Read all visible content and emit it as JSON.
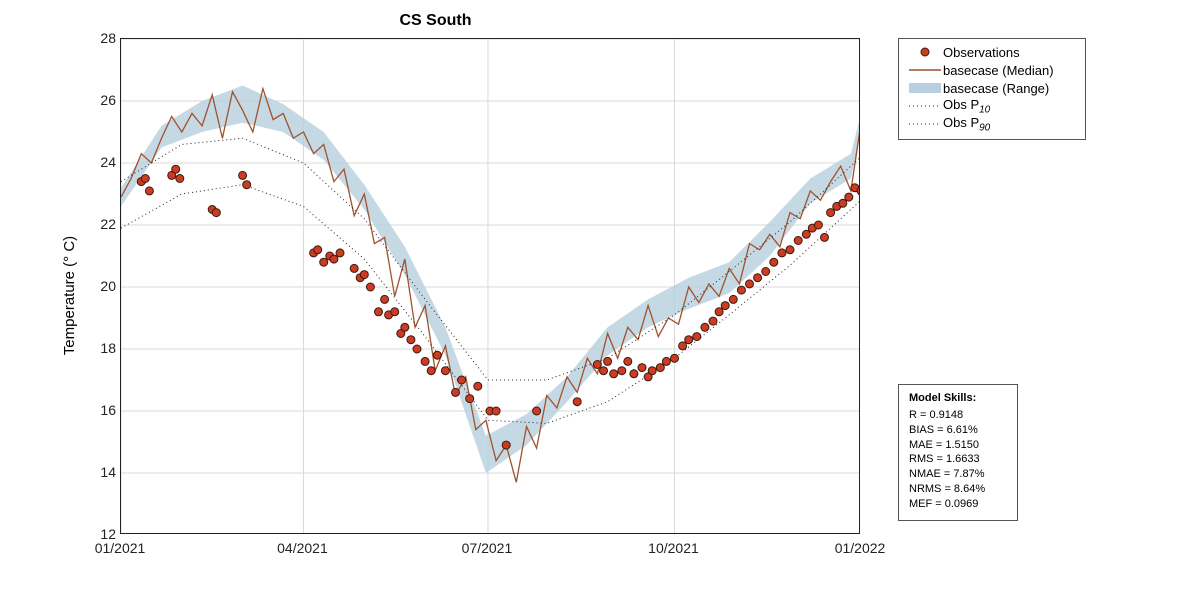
{
  "title": "CS South",
  "ylabel": "Temperature (° C)",
  "legend": {
    "obs": "Observations",
    "median": "basecase (Median)",
    "range": "basecase (Range)",
    "p10": "Obs P",
    "p10sub": "10",
    "p90": "Obs P",
    "p90sub": "90"
  },
  "skills": {
    "title": "Model Skills:",
    "R": "R     = 0.9148",
    "BIAS": "BIAS = 6.61%",
    "MAE": "MAE  = 1.5150",
    "RMS": "RMS  = 1.6633",
    "NMAE": "NMAE = 7.87%",
    "NRMS": "NRMS = 8.64%",
    "MEF": "MEF  = 0.0969"
  },
  "axes": {
    "xlim": [
      0,
      365
    ],
    "ylim": [
      12,
      28
    ],
    "xticks": [
      {
        "v": 0,
        "label": "01/2021"
      },
      {
        "v": 90,
        "label": "04/2021"
      },
      {
        "v": 181,
        "label": "07/2021"
      },
      {
        "v": 273,
        "label": "10/2021"
      },
      {
        "v": 365,
        "label": "01/2022"
      }
    ],
    "yticks": [
      12,
      14,
      16,
      18,
      20,
      22,
      24,
      26,
      28
    ]
  },
  "chart_data": {
    "type": "line",
    "title": "CS South",
    "xlabel": "",
    "ylabel": "Temperature (° C)",
    "xlim": [
      0,
      365
    ],
    "ylim": [
      12,
      28
    ],
    "x_tick_labels": [
      "01/2021",
      "04/2021",
      "07/2021",
      "10/2021",
      "01/2022"
    ],
    "series": [
      {
        "name": "basecase (Median)",
        "x": [
          0,
          5,
          10,
          15,
          20,
          25,
          30,
          35,
          40,
          45,
          50,
          55,
          60,
          65,
          70,
          75,
          80,
          85,
          90,
          95,
          100,
          105,
          110,
          115,
          120,
          125,
          130,
          135,
          140,
          145,
          150,
          155,
          160,
          165,
          170,
          175,
          180,
          185,
          190,
          195,
          200,
          205,
          210,
          215,
          220,
          225,
          230,
          235,
          240,
          245,
          250,
          255,
          260,
          265,
          270,
          275,
          280,
          285,
          290,
          295,
          300,
          305,
          310,
          315,
          320,
          325,
          330,
          335,
          340,
          345,
          350,
          355,
          360,
          365
        ],
        "y": [
          22.9,
          23.5,
          24.3,
          24.0,
          24.8,
          25.5,
          25.0,
          25.6,
          25.2,
          26.2,
          24.8,
          26.3,
          25.7,
          25.0,
          26.4,
          25.4,
          25.6,
          24.8,
          25.0,
          24.3,
          24.6,
          23.4,
          23.8,
          22.3,
          23.0,
          21.4,
          21.6,
          19.7,
          20.9,
          18.7,
          19.4,
          17.3,
          18.1,
          16.5,
          17.1,
          15.4,
          15.7,
          14.4,
          14.9,
          13.7,
          15.5,
          14.8,
          16.5,
          16.1,
          17.1,
          16.6,
          17.7,
          17.2,
          18.5,
          17.7,
          18.7,
          18.3,
          19.4,
          18.4,
          19.0,
          18.8,
          20.0,
          19.5,
          20.1,
          19.7,
          20.6,
          20.1,
          21.4,
          21.2,
          21.7,
          21.3,
          22.4,
          22.2,
          23.1,
          22.8,
          23.4,
          23.9,
          23.1,
          25.3
        ]
      },
      {
        "name": "basecase (Range low)",
        "x": [
          0,
          20,
          40,
          60,
          80,
          100,
          120,
          140,
          160,
          180,
          200,
          220,
          240,
          260,
          280,
          300,
          320,
          340,
          360,
          365
        ],
        "y": [
          22.6,
          24.5,
          25.0,
          25.3,
          25.0,
          24.1,
          22.5,
          20.4,
          17.8,
          14.0,
          14.9,
          16.3,
          17.8,
          18.7,
          19.3,
          19.8,
          21.0,
          22.7,
          23.5,
          25.0
        ]
      },
      {
        "name": "basecase (Range high)",
        "x": [
          0,
          20,
          40,
          60,
          80,
          100,
          120,
          140,
          160,
          180,
          200,
          220,
          240,
          260,
          280,
          300,
          320,
          340,
          360,
          365
        ],
        "y": [
          23.2,
          25.2,
          26.0,
          26.5,
          25.9,
          25.0,
          23.3,
          21.3,
          18.7,
          15.2,
          15.9,
          17.1,
          18.7,
          19.6,
          20.3,
          20.8,
          22.1,
          23.5,
          24.3,
          25.6
        ]
      },
      {
        "name": "Obs P10",
        "x": [
          0,
          30,
          60,
          90,
          120,
          150,
          181,
          210,
          240,
          273,
          300,
          330,
          365
        ],
        "y": [
          21.9,
          23.0,
          23.3,
          22.6,
          20.9,
          18.4,
          15.7,
          15.6,
          16.3,
          17.7,
          19.1,
          20.7,
          22.8
        ]
      },
      {
        "name": "Obs P90",
        "x": [
          0,
          30,
          60,
          90,
          120,
          150,
          181,
          210,
          240,
          273,
          300,
          330,
          365
        ],
        "y": [
          23.4,
          24.6,
          24.8,
          24.0,
          22.2,
          19.6,
          17.0,
          17.0,
          17.7,
          19.1,
          20.5,
          22.1,
          24.2
        ]
      },
      {
        "name": "Observations",
        "type": "scatter",
        "x": [
          10,
          12,
          14,
          25,
          27,
          29,
          45,
          47,
          60,
          62,
          95,
          97,
          100,
          103,
          105,
          108,
          115,
          118,
          120,
          123,
          127,
          130,
          132,
          135,
          138,
          140,
          143,
          146,
          150,
          153,
          156,
          160,
          165,
          168,
          172,
          176,
          182,
          185,
          190,
          205,
          225,
          235,
          238,
          240,
          243,
          247,
          250,
          253,
          257,
          260,
          262,
          266,
          269,
          273,
          277,
          280,
          284,
          288,
          292,
          295,
          298,
          302,
          306,
          310,
          314,
          318,
          322,
          326,
          330,
          334,
          338,
          341,
          344,
          347,
          350,
          353,
          356,
          359,
          362,
          365
        ],
        "y": [
          23.4,
          23.5,
          23.1,
          23.6,
          23.8,
          23.5,
          22.5,
          22.4,
          23.6,
          23.3,
          21.1,
          21.2,
          20.8,
          21.0,
          20.9,
          21.1,
          20.6,
          20.3,
          20.4,
          20.0,
          19.2,
          19.6,
          19.1,
          19.2,
          18.5,
          18.7,
          18.3,
          18.0,
          17.6,
          17.3,
          17.8,
          17.3,
          16.6,
          17.0,
          16.4,
          16.8,
          16.0,
          16.0,
          14.9,
          16.0,
          16.3,
          17.5,
          17.3,
          17.6,
          17.2,
          17.3,
          17.6,
          17.2,
          17.4,
          17.1,
          17.3,
          17.4,
          17.6,
          17.7,
          18.1,
          18.3,
          18.4,
          18.7,
          18.9,
          19.2,
          19.4,
          19.6,
          19.9,
          20.1,
          20.3,
          20.5,
          20.8,
          21.1,
          21.2,
          21.5,
          21.7,
          21.9,
          22.0,
          21.6,
          22.4,
          22.6,
          22.7,
          22.9,
          23.2,
          23.1
        ]
      }
    ]
  }
}
